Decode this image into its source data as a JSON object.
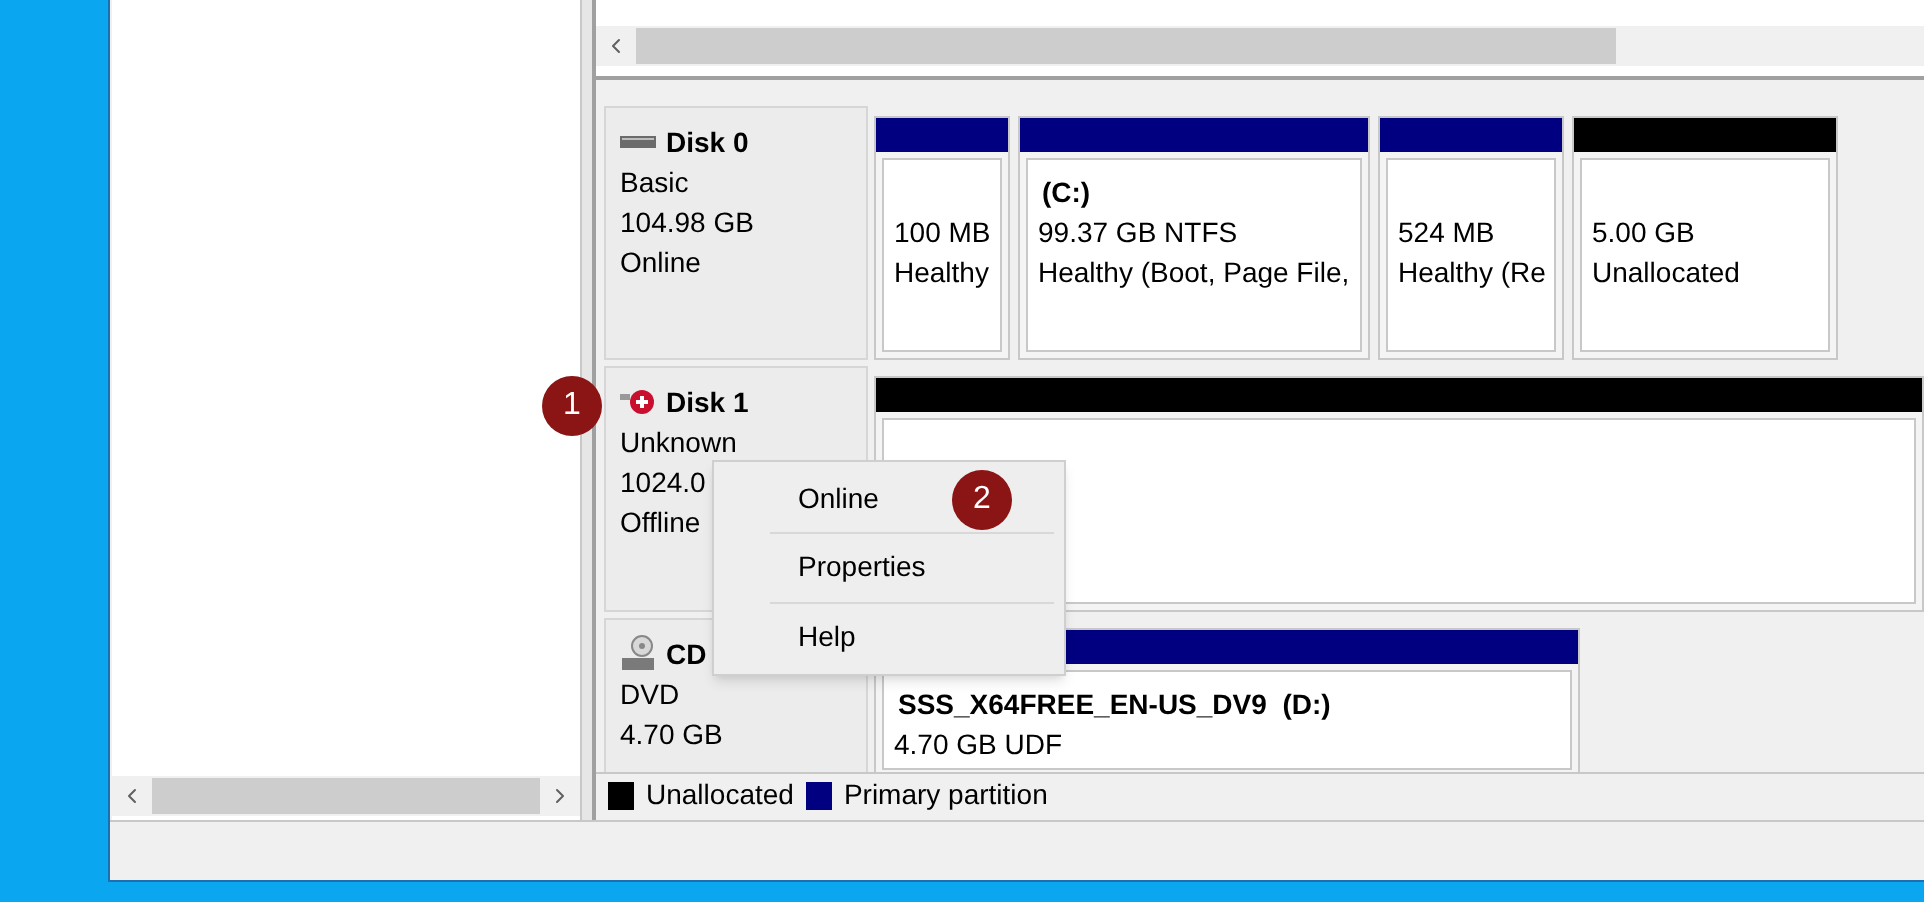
{
  "disks": [
    {
      "kind": "disk",
      "offline": false,
      "name": "Disk 0",
      "lines": [
        "Basic",
        "104.98 GB",
        "Online"
      ],
      "partitions": [
        {
          "kind": "primary",
          "lines": [
            "100 MB",
            "Healthy"
          ]
        },
        {
          "kind": "primary",
          "title": "(C:)",
          "lines": [
            "99.37 GB NTFS",
            "Healthy (Boot, Page File,"
          ]
        },
        {
          "kind": "primary",
          "lines": [
            "524 MB",
            "Healthy (Re"
          ]
        },
        {
          "kind": "unallocated",
          "lines": [
            "5.00 GB",
            "Unallocated"
          ]
        }
      ]
    },
    {
      "kind": "disk",
      "offline": true,
      "name": "Disk 1",
      "lines": [
        "Unknown",
        "1024.0",
        "Offline"
      ],
      "partitions": [
        {
          "kind": "unallocated"
        }
      ]
    },
    {
      "kind": "cdrom",
      "name": "CD",
      "lines": [
        "DVD",
        "4.70 GB"
      ],
      "partitions": [
        {
          "kind": "primary",
          "title": "SSS_X64FREE_EN-US_DV9  (D:)",
          "lines": [
            "4.70 GB UDF"
          ]
        }
      ]
    }
  ],
  "legend": [
    {
      "kind": "unallocated",
      "label": "Unallocated"
    },
    {
      "kind": "primary",
      "label": "Primary partition"
    }
  ],
  "context_menu": {
    "items": [
      "Online",
      "Properties",
      "Help"
    ]
  },
  "step_badges": [
    "1",
    "2"
  ]
}
